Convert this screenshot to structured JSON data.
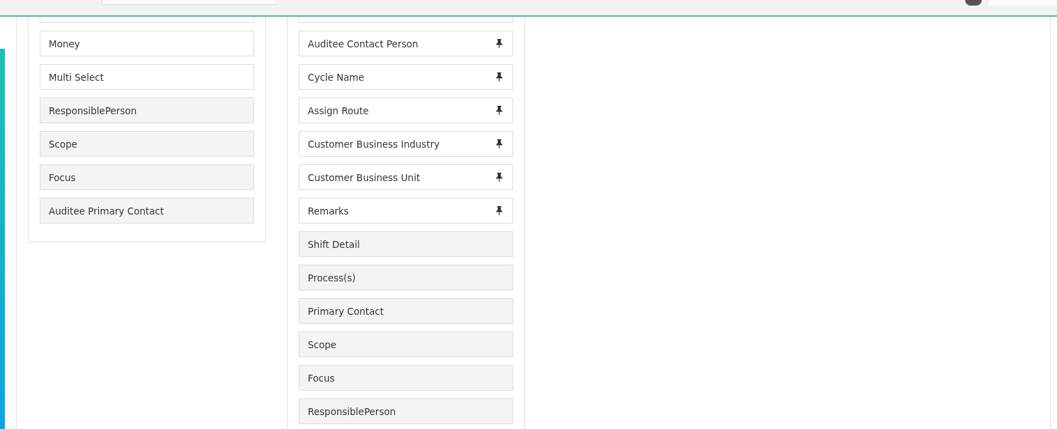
{
  "columns": [
    {
      "items": [
        {
          "kind": "cut"
        },
        {
          "kind": "active",
          "label": "Money"
        },
        {
          "kind": "active",
          "label": "Multi Select"
        },
        {
          "kind": "inactive",
          "label": "ResponsiblePerson"
        },
        {
          "kind": "inactive",
          "label": "Scope"
        },
        {
          "kind": "inactive",
          "label": "Focus"
        },
        {
          "kind": "inactive",
          "label": "Auditee Primary Contact"
        }
      ]
    },
    {
      "items": [
        {
          "kind": "cut"
        },
        {
          "kind": "pinned",
          "label": "Auditee Contact Person"
        },
        {
          "kind": "pinned",
          "label": "Cycle Name"
        },
        {
          "kind": "pinned",
          "label": "Assign Route"
        },
        {
          "kind": "pinned",
          "label": "Customer Business Industry"
        },
        {
          "kind": "pinned",
          "label": "Customer Business Unit"
        },
        {
          "kind": "pinned",
          "label": "Remarks"
        },
        {
          "kind": "inactive",
          "label": "Shift Detail"
        },
        {
          "kind": "inactive",
          "label": "Process(s)"
        },
        {
          "kind": "inactive",
          "label": "Primary Contact"
        },
        {
          "kind": "inactive",
          "label": "Scope"
        },
        {
          "kind": "inactive",
          "label": "Focus"
        },
        {
          "kind": "inactive",
          "label": "ResponsiblePerson"
        }
      ]
    }
  ]
}
